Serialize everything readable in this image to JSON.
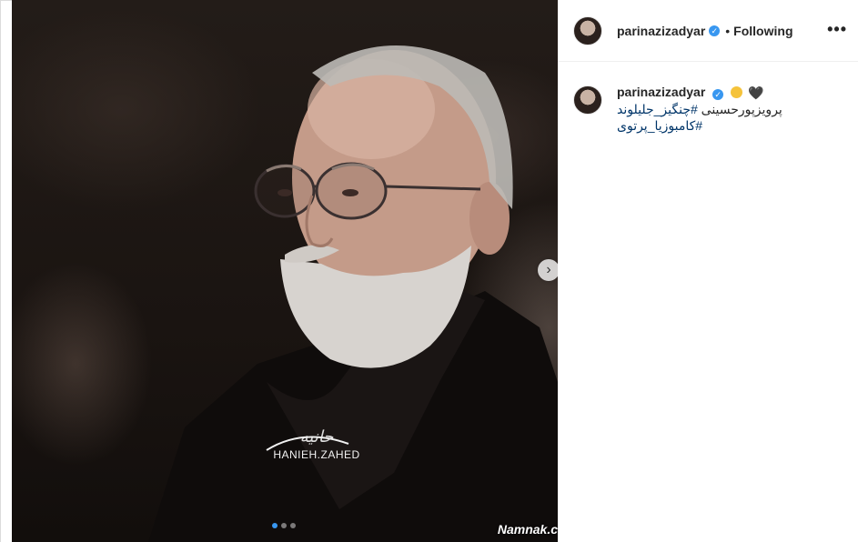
{
  "post": {
    "username": "parinazizadyar",
    "separator": "•",
    "follow_label": "Following",
    "more_label": "•••",
    "verified_mark": "✓"
  },
  "caption": {
    "username": "parinazizadyar",
    "emoji_heart": "🖤",
    "line1_text": "پرویزپورحسینی ",
    "line1_tag": "#چنگیز_جلیلوند",
    "line2_tag": "#کامبوزیا_پرتوی"
  },
  "media": {
    "watermark_script": "حانیه",
    "watermark_name": "HANIEH.ZAHED",
    "corner_mark": "Namnak.c",
    "next_icon": "›",
    "slide_count": 3,
    "active_slide": 1
  },
  "colors": {
    "link": "#003569",
    "verified": "#3897f0",
    "active_dot": "#3897f0"
  }
}
